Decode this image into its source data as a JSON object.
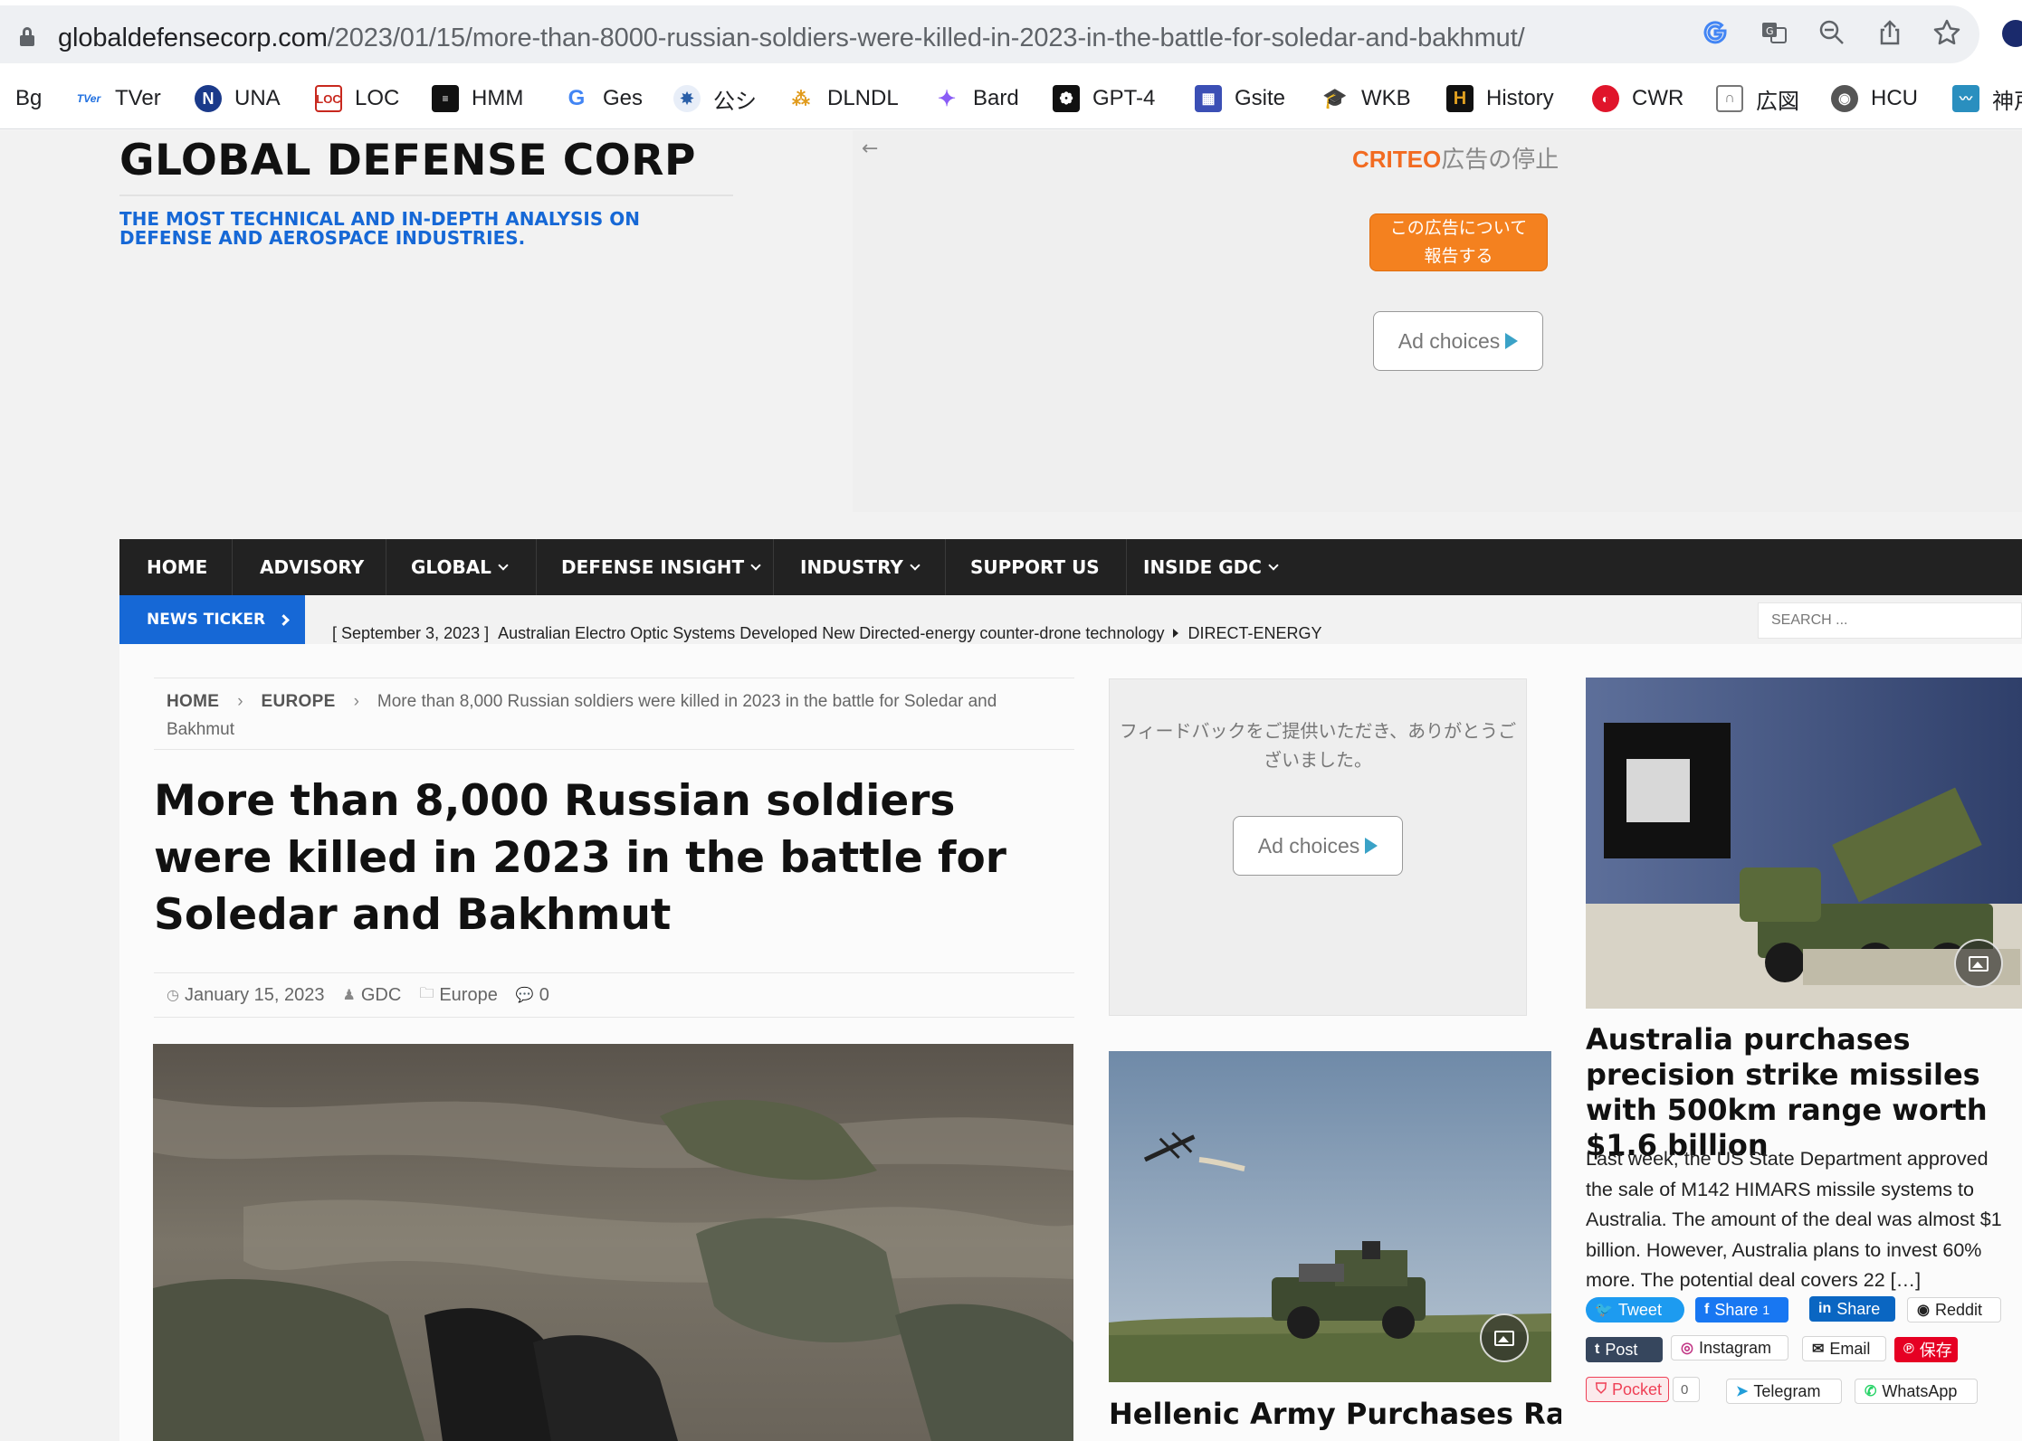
{
  "browser": {
    "url_host": "globaldefensecorp.com",
    "url_path": "/2023/01/15/more-than-8000-russian-soldiers-were-killed-in-2023-in-the-battle-for-soledar-and-bakhmut/",
    "bookmarks": [
      {
        "label": "Bg",
        "icon": "none"
      },
      {
        "label": "TVer",
        "icon": "tver-icon",
        "color": "#1f6fe0"
      },
      {
        "label": "UNA",
        "icon": "n-circle-icon",
        "color": "#1b3a8a"
      },
      {
        "label": "LOC",
        "icon": "loc-icon",
        "color": "#c8281e"
      },
      {
        "label": "HMM",
        "icon": "hmm-icon",
        "color": "#111111"
      },
      {
        "label": "Ges",
        "icon": "google-icon",
        "color": "#4285f4"
      },
      {
        "label": "公シ",
        "icon": "emblem-icon",
        "color": "#2a5fa8"
      },
      {
        "label": "DLNDL",
        "icon": "dlndl-icon",
        "color": "#e09a1a"
      },
      {
        "label": "Bard",
        "icon": "bard-sparkle-icon",
        "color": "#8a5cf6"
      },
      {
        "label": "GPT-4",
        "icon": "openai-icon",
        "color": "#111111"
      },
      {
        "label": "Gsite",
        "icon": "gsite-icon",
        "color": "#3b4fb5"
      },
      {
        "label": "WKB",
        "icon": "graduation-cap-icon",
        "color": "#2b3a8a"
      },
      {
        "label": "History",
        "icon": "history-h-icon",
        "color": "#111111"
      },
      {
        "label": "CWR",
        "icon": "cwr-icon",
        "color": "#e0152b"
      },
      {
        "label": "広図",
        "icon": "n-box-icon",
        "color": "#777777"
      },
      {
        "label": "HCU",
        "icon": "globe-icon",
        "color": "#555555"
      },
      {
        "label": "神戸",
        "icon": "kobe-icon",
        "color": "#2a8fbf"
      }
    ]
  },
  "site": {
    "title": "GLOBAL DEFENSE CORP",
    "tagline": "THE MOST TECHNICAL AND IN-DEPTH ANALYSIS ON DEFENSE AND AEROSPACE INDUSTRIES."
  },
  "ads": {
    "criteo_brand": "CRITEO",
    "stop_label": "広告の停止",
    "report_label": "この広告について\n報告する",
    "ad_choices": "Ad choices",
    "feedback": "フィードバックをご提供いただき、ありがとうございました。"
  },
  "nav": {
    "items": [
      {
        "label": "HOME",
        "dropdown": false
      },
      {
        "label": "ADVISORY",
        "dropdown": false
      },
      {
        "label": "GLOBAL",
        "dropdown": true
      },
      {
        "label": "DEFENSE INSIGHT",
        "dropdown": true
      },
      {
        "label": "INDUSTRY",
        "dropdown": true
      },
      {
        "label": "SUPPORT US",
        "dropdown": false
      },
      {
        "label": "INSIDE GDC",
        "dropdown": true
      }
    ]
  },
  "ticker": {
    "label": "NEWS TICKER",
    "date": "[ September 3, 2023 ]",
    "headline": "Australian Electro Optic Systems Developed New Directed-energy counter-drone technology",
    "category": "DIRECT-ENERGY",
    "search_placeholder": "SEARCH ..."
  },
  "article": {
    "breadcrumb_home": "HOME",
    "breadcrumb_section": "EUROPE",
    "breadcrumb_current": "More than 8,000 Russian soldiers were killed in 2023 in the battle for Soledar and Bakhmut",
    "title": "More than 8,000 Russian soldiers were killed in 2023 in the battle for Soledar and Bakhmut",
    "date": "January 15, 2023",
    "author": "GDC",
    "category": "Europe",
    "comments": "0"
  },
  "sidebar": {
    "post1_title": "Hellenic Army Purchases Rafael Spike NLOS Missiles",
    "post2_title": "Australia purchases precision strike missiles with 500km range worth $1.6 billion",
    "post2_excerpt": "Last week, the US State Department approved the sale of M142 HIMARS missile systems to Australia. The amount of the deal was almost $1 billion. However, Australia plans to invest 60% more. The potential deal covers 22 […]"
  },
  "share": {
    "tweet": "Tweet",
    "fb_share": "Share",
    "fb_count": "1",
    "li_share": "Share",
    "reddit": "Reddit",
    "post": "Post",
    "instagram": "Instagram",
    "email": "Email",
    "pin": "保存",
    "pocket": "Pocket",
    "pocket_count": "0",
    "telegram": "Telegram",
    "whatsapp": "WhatsApp"
  }
}
